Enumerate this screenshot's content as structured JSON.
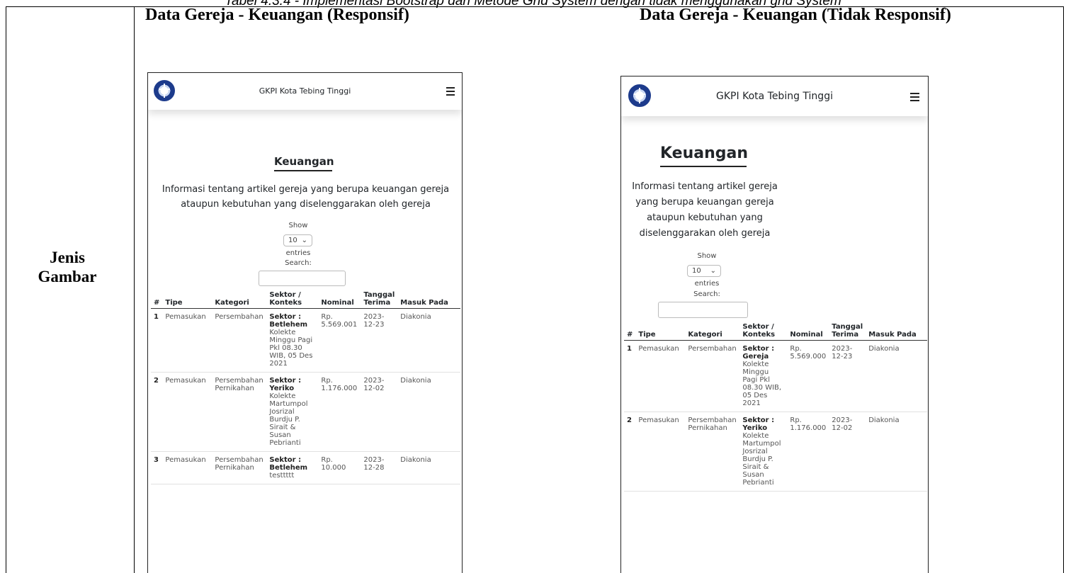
{
  "caption": "Tabel 4.3.4 - Implementasi Bootstrap dan Metode Grid System dengan tidak menggunakan grid System",
  "row_label": "Jenis Gambar",
  "columns": {
    "left_title": "Data Gereja - Keuangan (Responsif)",
    "right_title": "Data Gereja - Keuangan (Tidak Responsif)"
  },
  "shots": [
    {
      "brand": "GKPI Kota Tebing Tinggi",
      "heading": "Keuangan",
      "lead": "Informasi tentang artikel gereja yang berupa keuangan gereja ataupun kebutuhan yang diselenggarakan oleh gereja",
      "show_label": "Show",
      "entries_value": "10",
      "entries_label": "entries",
      "search_label": "Search:",
      "headers": [
        "#",
        "Tipe",
        "Kategori",
        "Sektor / Konteks",
        "Nominal",
        "Tanggal Terima",
        "Masuk Pada"
      ],
      "rows": [
        {
          "no": "1",
          "tipe": "Pemasukan",
          "kategori": "Persembahan",
          "sektor": "Sektor : Betlehem",
          "konteks": "Kolekte Minggu Pagi Pkl 08.30 WIB, 05 Des 2021",
          "nominal": "Rp. 5.569.001",
          "tanggal": "2023-12-23",
          "masuk": "Diakonia"
        },
        {
          "no": "2",
          "tipe": "Pemasukan",
          "kategori": "Persembahan Pernikahan",
          "sektor": "Sektor : Yeriko",
          "konteks": "Kolekte Martumpol Josrizal Burdju P. Sirait & Susan Pebrianti",
          "nominal": "Rp. 1.176.000",
          "tanggal": "2023-12-02",
          "masuk": "Diakonia"
        },
        {
          "no": "3",
          "tipe": "Pemasukan",
          "kategori": "Persembahan Pernikahan",
          "sektor": "Sektor : Betlehem",
          "konteks": "testtttt",
          "nominal": "Rp. 10.000",
          "tanggal": "2023-12-28",
          "masuk": "Diakonia"
        }
      ]
    },
    {
      "brand": "GKPI Kota Tebing Tinggi",
      "heading": "Keuangan",
      "lead": "Informasi tentang artikel gereja yang berupa keuangan gereja ataupun kebutuhan yang diselenggarakan oleh gereja",
      "show_label": "Show",
      "entries_value": "10",
      "entries_label": "entries",
      "search_label": "Search:",
      "headers": [
        "#",
        "Tipe",
        "Kategori",
        "Sektor / Konteks",
        "Nominal",
        "Tanggal Terima",
        "Masuk Pada"
      ],
      "rows": [
        {
          "no": "1",
          "tipe": "Pemasukan",
          "kategori": "Persembahan",
          "sektor": "Sektor : Gereja",
          "konteks": "Kolekte Minggu Pagi Pkl 08.30 WIB, 05 Des 2021",
          "nominal": "Rp. 5.569.000",
          "tanggal": "2023-12-23",
          "masuk": "Diakonia"
        },
        {
          "no": "2",
          "tipe": "Pemasukan",
          "kategori": "Persembahan Pernikahan",
          "sektor": "Sektor : Yeriko",
          "konteks": "Kolekte Martumpol Josrizal Burdju P. Sirait & Susan Pebrianti",
          "nominal": "Rp. 1.176.000",
          "tanggal": "2023-12-02",
          "masuk": "Diakonia"
        }
      ]
    }
  ]
}
